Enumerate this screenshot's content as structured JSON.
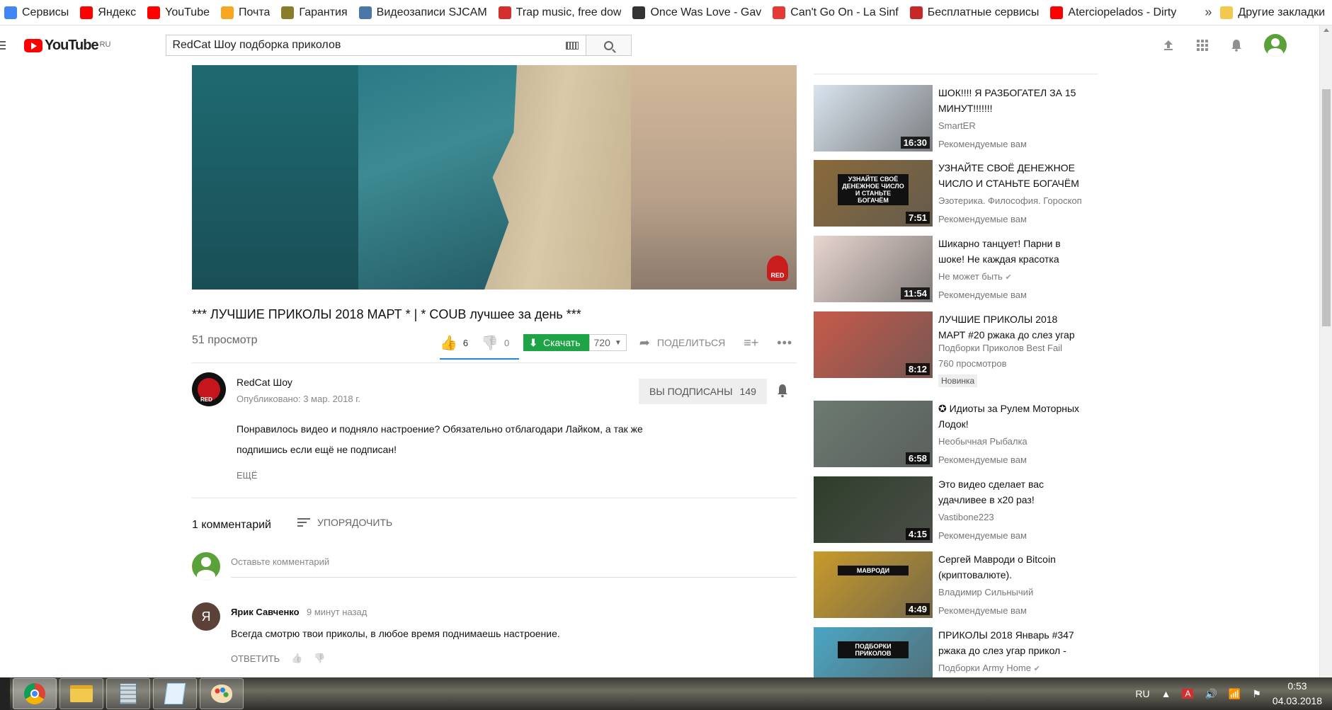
{
  "bookmarks": {
    "items": [
      {
        "label": "Сервисы",
        "icon": "apps-icon",
        "color": "#4285f4"
      },
      {
        "label": "Яндекс",
        "icon": "yandex-icon",
        "color": "#f00"
      },
      {
        "label": "YouTube",
        "icon": "youtube-icon",
        "color": "#f00"
      },
      {
        "label": "Почта",
        "icon": "mail-icon",
        "color": "#f5a623"
      },
      {
        "label": "Гарантия",
        "icon": "guarantee-icon",
        "color": "#8a7d2a"
      },
      {
        "label": "Видеозаписи SJCAM",
        "icon": "vk-icon",
        "color": "#4a76a8"
      },
      {
        "label": "Trap music, free dow",
        "icon": "trap-icon",
        "color": "#d32f2f"
      },
      {
        "label": "Once Was Love - Gav",
        "icon": "pause-icon",
        "color": "#333"
      },
      {
        "label": "Can't Go On - La Sinf",
        "icon": "music-note-icon",
        "color": "#e53935"
      },
      {
        "label": "Бесплатные сервисы",
        "icon": "k-icon",
        "color": "#c62828"
      },
      {
        "label": "Aterciopelados - Dirty",
        "icon": "youtube-icon",
        "color": "#f00"
      }
    ],
    "more": "»",
    "other": "Другие закладки"
  },
  "header": {
    "logo_text": "YouTube",
    "region": "RU",
    "search_value": "RedCat Шоу подборка приколов"
  },
  "video": {
    "watermark": "RED",
    "title": "*** ЛУЧШИЕ ПРИКОЛЫ 2018 МАРТ * | * COUB лучшее за день ***",
    "views": "51 просмотр",
    "likes": "6",
    "dislikes": "0",
    "download_label": "Скачать",
    "quality": "720",
    "share_label": "ПОДЕЛИТЬСЯ"
  },
  "channel": {
    "name": "RedCat Шоу",
    "published": "Опубликовано: 3 мар. 2018 г.",
    "subscribed_label": "ВЫ ПОДПИСАНЫ",
    "subscribers": "149",
    "description": "Понравилось видео и подняло настроение? Обязательно отблагодари Лайком, а так же подпишись если ещё не подписан!",
    "more_label": "ЕЩЁ"
  },
  "comments": {
    "count_label": "1 комментарий",
    "sort_label": "УПОРЯДОЧИТЬ",
    "input_placeholder": "Оставьте комментарий",
    "items": [
      {
        "avatar_letter": "Я",
        "author": "Ярик Савченко",
        "time": "9 минут назад",
        "text": "Всегда смотрю твои приколы, в любое время поднимаешь настроение.",
        "reply_label": "ОТВЕТИТЬ"
      }
    ]
  },
  "recommendations": [
    {
      "title": "ШОК!!!! Я РАЗБОГАТЕЛ ЗА 15 МИНУТ!!!!!!!",
      "channel": "SmartER",
      "meta": "Рекомендуемые вам",
      "duration": "16:30",
      "thumb_color": "#d9e4ef",
      "verified": false
    },
    {
      "title": "УЗНАЙТЕ СВОЁ ДЕНЕЖНОЕ ЧИСЛО И СТАНЬТЕ БОГАЧЁМ",
      "channel": "Эзотерика. Философия. Гороскоп",
      "meta": "Рекомендуемые вам",
      "duration": "7:51",
      "thumb_color": "#8a6a3a",
      "thumb_text": "УЗНАЙТЕ СВОЁ ДЕНЕЖНОЕ ЧИСЛО И СТАНЬТЕ БОГАЧЁМ",
      "verified": false
    },
    {
      "title": "Шикарно танцует! Парни в шоке! Не каждая красотка",
      "channel": "Не может быть",
      "meta": "Рекомендуемые вам",
      "duration": "11:54",
      "thumb_color": "#e8d6d0",
      "verified": true
    },
    {
      "title": "ЛУЧШИЕ ПРИКОЛЫ 2018 МАРТ #20 ржака до слез угар",
      "channel": "Подборки Приколов Best Fail",
      "meta": "760 просмотров",
      "badge": "Новинка",
      "duration": "8:12",
      "thumb_color": "#c75a4a",
      "verified": false
    },
    {
      "title": "✪ Идиоты за Рулем Моторных Лодок!",
      "channel": "Необычная Рыбалка",
      "meta": "Рекомендуемые вам",
      "duration": "6:58",
      "thumb_color": "#6b7a70",
      "verified": false
    },
    {
      "title": "Это видео сделает вас удачливее в х20 раз!",
      "channel": "Vastibone223",
      "meta": "Рекомендуемые вам",
      "duration": "4:15",
      "thumb_color": "#2f3d2a",
      "verified": false
    },
    {
      "title": "Сергей Мавроди о Bitcoin (криптовалюте).",
      "channel": "Владимир Сильнычий",
      "meta": "Рекомендуемые вам",
      "duration": "4:49",
      "thumb_color": "#c89a2a",
      "thumb_text": "МАВРОДИ",
      "verified": false
    },
    {
      "title": "ПРИКОЛЫ 2018 Январь #347 ржака до слез угар прикол -",
      "channel": "Подборки Army Home",
      "meta": "",
      "duration": "",
      "thumb_color": "#4aa6c4",
      "thumb_text": "ПОДБОРКИ ПРИКОЛОВ",
      "verified": true
    }
  ],
  "taskbar": {
    "apps": [
      "chrome-icon",
      "explorer-icon",
      "calculator-icon",
      "notepad-icon",
      "paint-icon"
    ],
    "lang": "RU",
    "time": "0:53",
    "date": "04.03.2018"
  }
}
